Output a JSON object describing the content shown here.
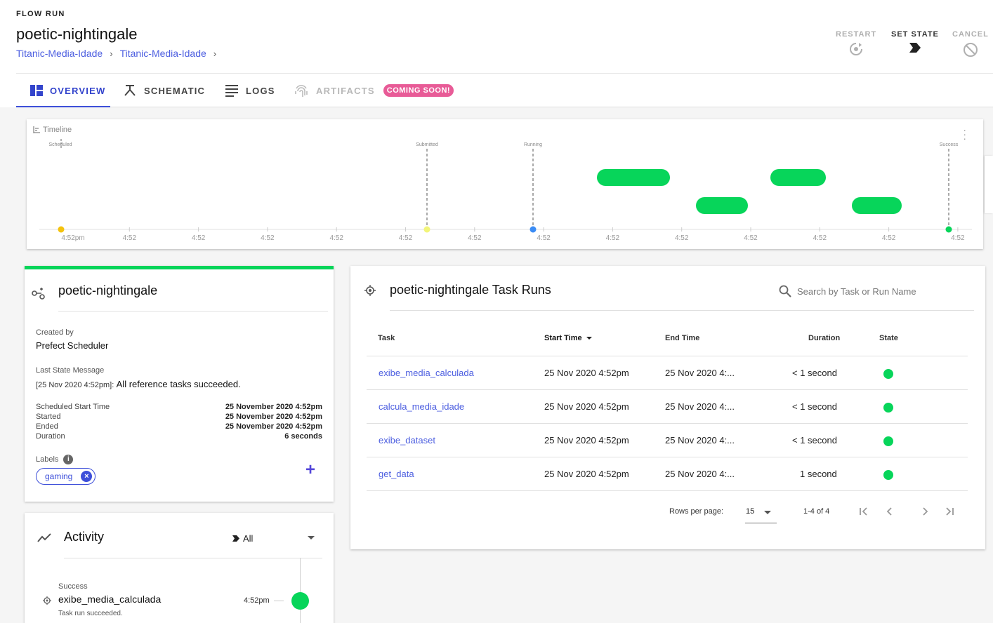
{
  "header": {
    "eyebrow": "FLOW RUN",
    "title": "poetic-nightingale",
    "breadcrumbs": [
      "Titanic-Media-Idade",
      "Titanic-Media-Idade"
    ],
    "actions": {
      "restart": "RESTART",
      "set_state": "SET STATE",
      "cancel": "CANCEL"
    }
  },
  "tabs": {
    "overview": "OVERVIEW",
    "schematic": "SCHEMATIC",
    "logs": "LOGS",
    "artifacts": "ARTIFACTS",
    "coming_soon": "COMING SOON!"
  },
  "timeline": {
    "title": "Timeline",
    "markers": [
      "Scheduled",
      "Submitted",
      "Running",
      "Success"
    ],
    "ticks": [
      "4:52pm",
      "4:52",
      "4:52",
      "4:52",
      "4:52",
      "4:52",
      "4:52",
      "4:52",
      "4:52",
      "4:52",
      "4:52",
      "4:52",
      "4:52",
      "4:52"
    ]
  },
  "info": {
    "title": "poetic-nightingale",
    "created_by_label": "Created by",
    "created_by": "Prefect Scheduler",
    "last_state_label": "Last State Message",
    "last_state_prefix": "[25 Nov 2020 4:52pm]:",
    "last_state_message": "All reference tasks succeeded.",
    "details": [
      {
        "key": "Scheduled Start Time",
        "value": "25 November 2020 4:52pm"
      },
      {
        "key": "Started",
        "value": "25 November 2020 4:52pm"
      },
      {
        "key": "Ended",
        "value": "25 November 2020 4:52pm"
      },
      {
        "key": "Duration",
        "value": "6 seconds"
      }
    ],
    "labels_label": "Labels",
    "label_chip": "gaming"
  },
  "activity": {
    "title": "Activity",
    "filter": "All",
    "entry_state": "Success",
    "entry_name": "exibe_media_calculada",
    "entry_time": "4:52pm",
    "entry_message": "Task run succeeded."
  },
  "tasks": {
    "title": "poetic-nightingale Task Runs",
    "search_placeholder": "Search by Task or Run Name",
    "columns": {
      "task": "Task",
      "start": "Start Time",
      "end": "End Time",
      "duration": "Duration",
      "state": "State"
    },
    "rows": [
      {
        "task": "exibe_media_calculada",
        "start": "25 Nov 2020 4:52pm",
        "end": "25 Nov 2020 4:...",
        "duration": "< 1 second"
      },
      {
        "task": "calcula_media_idade",
        "start": "25 Nov 2020 4:52pm",
        "end": "25 Nov 2020 4:...",
        "duration": "< 1 second"
      },
      {
        "task": "exibe_dataset",
        "start": "25 Nov 2020 4:52pm",
        "end": "25 Nov 2020 4:...",
        "duration": "< 1 second"
      },
      {
        "task": "get_data",
        "start": "25 Nov 2020 4:52pm",
        "end": "25 Nov 2020 4:...",
        "duration": "1 second"
      }
    ],
    "rows_per_page_label": "Rows per page:",
    "rows_per_page": "15",
    "range": "1-4 of 4"
  },
  "colors": {
    "accent": "#3d4fd9",
    "success": "#07d55a",
    "scheduled": "#f4c20d",
    "submitted": "#f2f57a",
    "running": "#3b8cf5",
    "coming_soon": "#e85b97"
  }
}
